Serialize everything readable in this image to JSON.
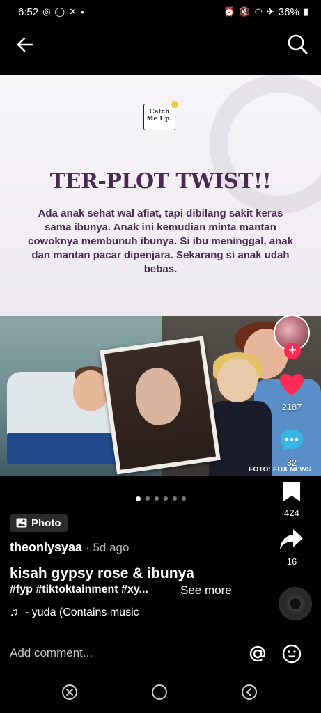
{
  "status_bar": {
    "time": "6:52",
    "battery": "36%"
  },
  "post": {
    "logo_text": "Catch Me Up!",
    "headline": "TER-PLOT TWIST!!",
    "body": "Ada anak sehat wal afiat, tapi dibilang sakit keras sama ibunya. Anak ini kemudian minta mantan cowoknya membunuh ibunya. Si ibu meninggal, anak dan mantan pacar dipenjara. Sekarang si anak udah bebas.",
    "photo_credit": "FOTO: FOX NEWS"
  },
  "actions": {
    "likes": "2187",
    "comments": "32",
    "bookmarks": "424",
    "shares": "16"
  },
  "carousel": {
    "total": 6,
    "active": 0
  },
  "meta": {
    "badge": "Photo",
    "author": "theonlysyaa",
    "time": "· 5d ago",
    "title": "kisah gypsy rose & ibunya",
    "hashtags": "#fyp #tiktoktainment #xy...",
    "see_more": "See more",
    "music": "- yuda (Contains music"
  },
  "comment": {
    "placeholder": "Add comment..."
  },
  "colors": {
    "like": "#fe2c55",
    "headline": "#4a2a54",
    "comment_icon": "#35b8e6"
  }
}
